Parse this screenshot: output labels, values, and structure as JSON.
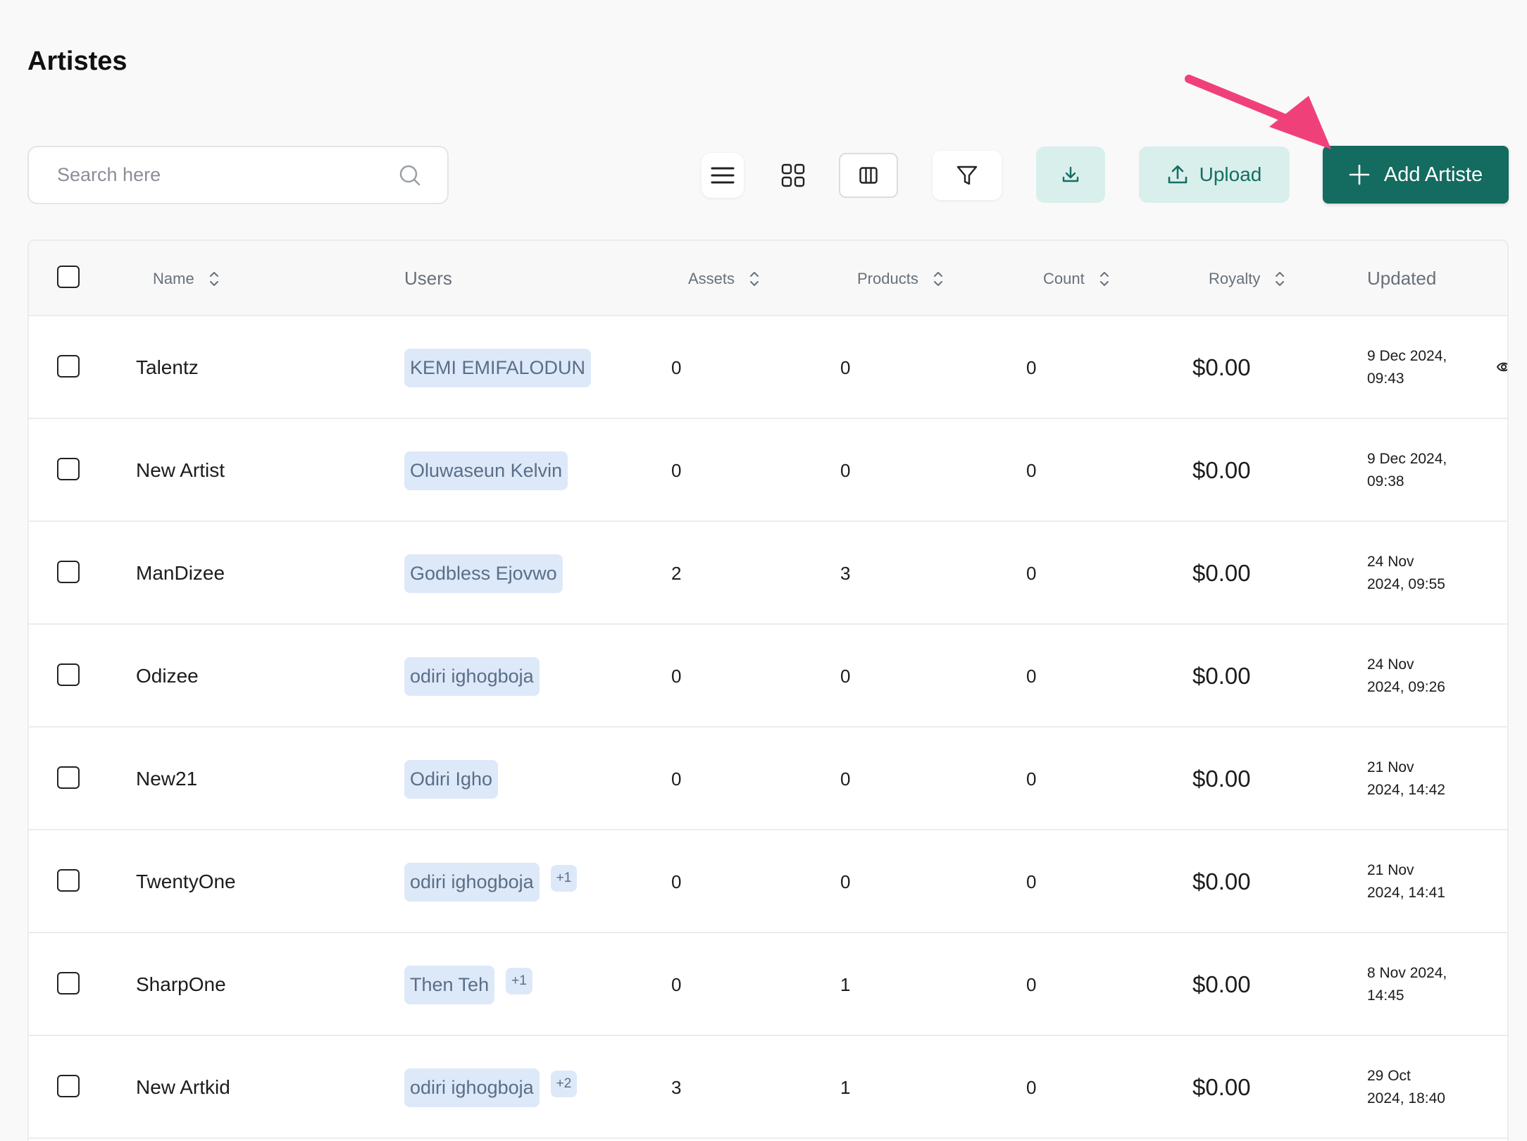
{
  "page": {
    "title": "Artistes"
  },
  "search": {
    "placeholder": "Search here"
  },
  "toolbar": {
    "upload_label": "Upload",
    "add_label": "Add Artiste",
    "accent_color": "#146b5f",
    "soft_color": "#d9efec",
    "annotation_arrow_color": "#f0407a"
  },
  "table": {
    "headers": {
      "name": "Name",
      "users": "Users",
      "assets": "Assets",
      "products": "Products",
      "count": "Count",
      "royalty": "Royalty",
      "updated": "Updated"
    },
    "rows": [
      {
        "name": "Talentz",
        "user": "KEMI EMIFALODUN",
        "extra": "",
        "assets": "0",
        "products": "0",
        "count": "0",
        "royalty": "$0.00",
        "updated": "9 Dec 2024, 09:43"
      },
      {
        "name": "New Artist",
        "user": "Oluwaseun Kelvin",
        "extra": "",
        "assets": "0",
        "products": "0",
        "count": "0",
        "royalty": "$0.00",
        "updated": "9 Dec 2024, 09:38"
      },
      {
        "name": "ManDizee",
        "user": "Godbless Ejovwo",
        "extra": "",
        "assets": "2",
        "products": "3",
        "count": "0",
        "royalty": "$0.00",
        "updated": "24 Nov 2024, 09:55"
      },
      {
        "name": "Odizee",
        "user": "odiri ighogboja",
        "extra": "",
        "assets": "0",
        "products": "0",
        "count": "0",
        "royalty": "$0.00",
        "updated": "24 Nov 2024, 09:26"
      },
      {
        "name": "New21",
        "user": "Odiri Igho",
        "extra": "",
        "assets": "0",
        "products": "0",
        "count": "0",
        "royalty": "$0.00",
        "updated": "21 Nov 2024, 14:42"
      },
      {
        "name": "TwentyOne",
        "user": "odiri ighogboja",
        "extra": "+1",
        "assets": "0",
        "products": "0",
        "count": "0",
        "royalty": "$0.00",
        "updated": "21 Nov 2024, 14:41"
      },
      {
        "name": "SharpOne",
        "user": "Then Teh",
        "extra": "+1",
        "assets": "0",
        "products": "1",
        "count": "0",
        "royalty": "$0.00",
        "updated": "8 Nov 2024, 14:45"
      },
      {
        "name": "New Artkid",
        "user": "odiri ighogboja",
        "extra": "+2",
        "assets": "3",
        "products": "1",
        "count": "0",
        "royalty": "$0.00",
        "updated": "29 Oct 2024, 18:40"
      }
    ]
  }
}
